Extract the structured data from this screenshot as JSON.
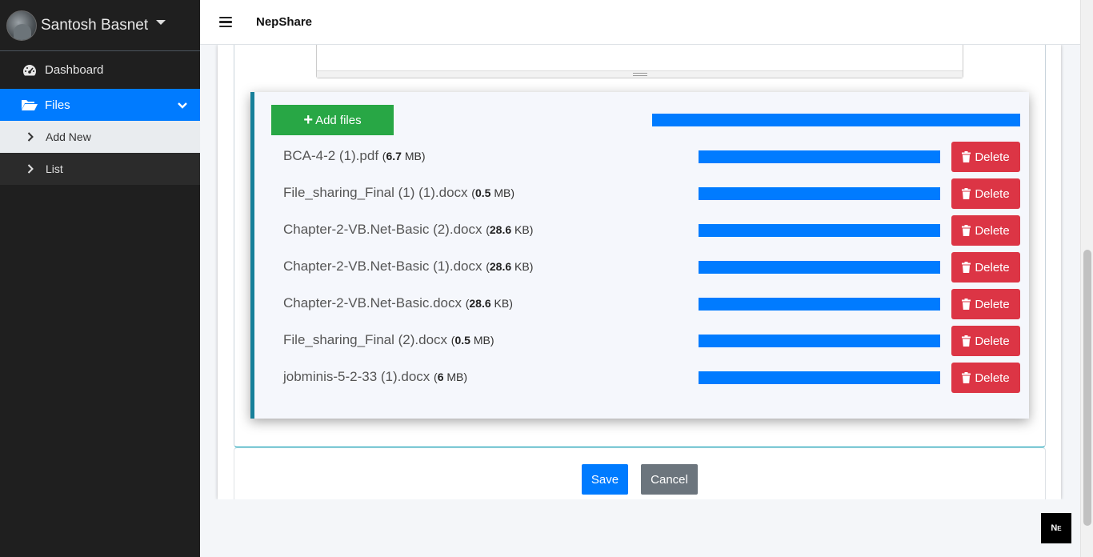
{
  "sidebar": {
    "user_name": "Santosh Basnet",
    "items": [
      {
        "label": "Dashboard",
        "icon": "tachometer-icon"
      },
      {
        "label": "Files",
        "icon": "folder-open-icon",
        "active": true
      }
    ],
    "sub_items": [
      {
        "label": "Add New"
      },
      {
        "label": "List"
      }
    ]
  },
  "header": {
    "brand": "NepShare"
  },
  "uploader": {
    "add_files_label": "Add files",
    "total_progress": 1.0,
    "files": [
      {
        "name": "BCA-4-2 (1).pdf",
        "size_value": "6.7",
        "size_unit": "MB",
        "progress": 1.0,
        "delete_label": "Delete"
      },
      {
        "name": "File_sharing_Final (1) (1).docx",
        "size_value": "0.5",
        "size_unit": "MB",
        "progress": 1.0,
        "delete_label": "Delete"
      },
      {
        "name": "Chapter-2-VB.Net-Basic (2).docx",
        "size_value": "28.6",
        "size_unit": "KB",
        "progress": 1.0,
        "delete_label": "Delete"
      },
      {
        "name": "Chapter-2-VB.Net-Basic (1).docx",
        "size_value": "28.6",
        "size_unit": "KB",
        "progress": 1.0,
        "delete_label": "Delete"
      },
      {
        "name": "Chapter-2-VB.Net-Basic.docx",
        "size_value": "28.6",
        "size_unit": "KB",
        "progress": 1.0,
        "delete_label": "Delete"
      },
      {
        "name": "File_sharing_Final (2).docx",
        "size_value": "0.5",
        "size_unit": "MB",
        "progress": 1.0,
        "delete_label": "Delete"
      },
      {
        "name": "jobminis-5-2-33 (1).docx",
        "size_value": "6",
        "size_unit": "MB",
        "progress": 1.0,
        "delete_label": "Delete"
      }
    ]
  },
  "footer": {
    "save_label": "Save",
    "cancel_label": "Cancel"
  },
  "colors": {
    "primary": "#007bff",
    "success": "#28a745",
    "danger": "#dc3545",
    "secondary": "#6c757d",
    "accent_border": "#17809a"
  }
}
